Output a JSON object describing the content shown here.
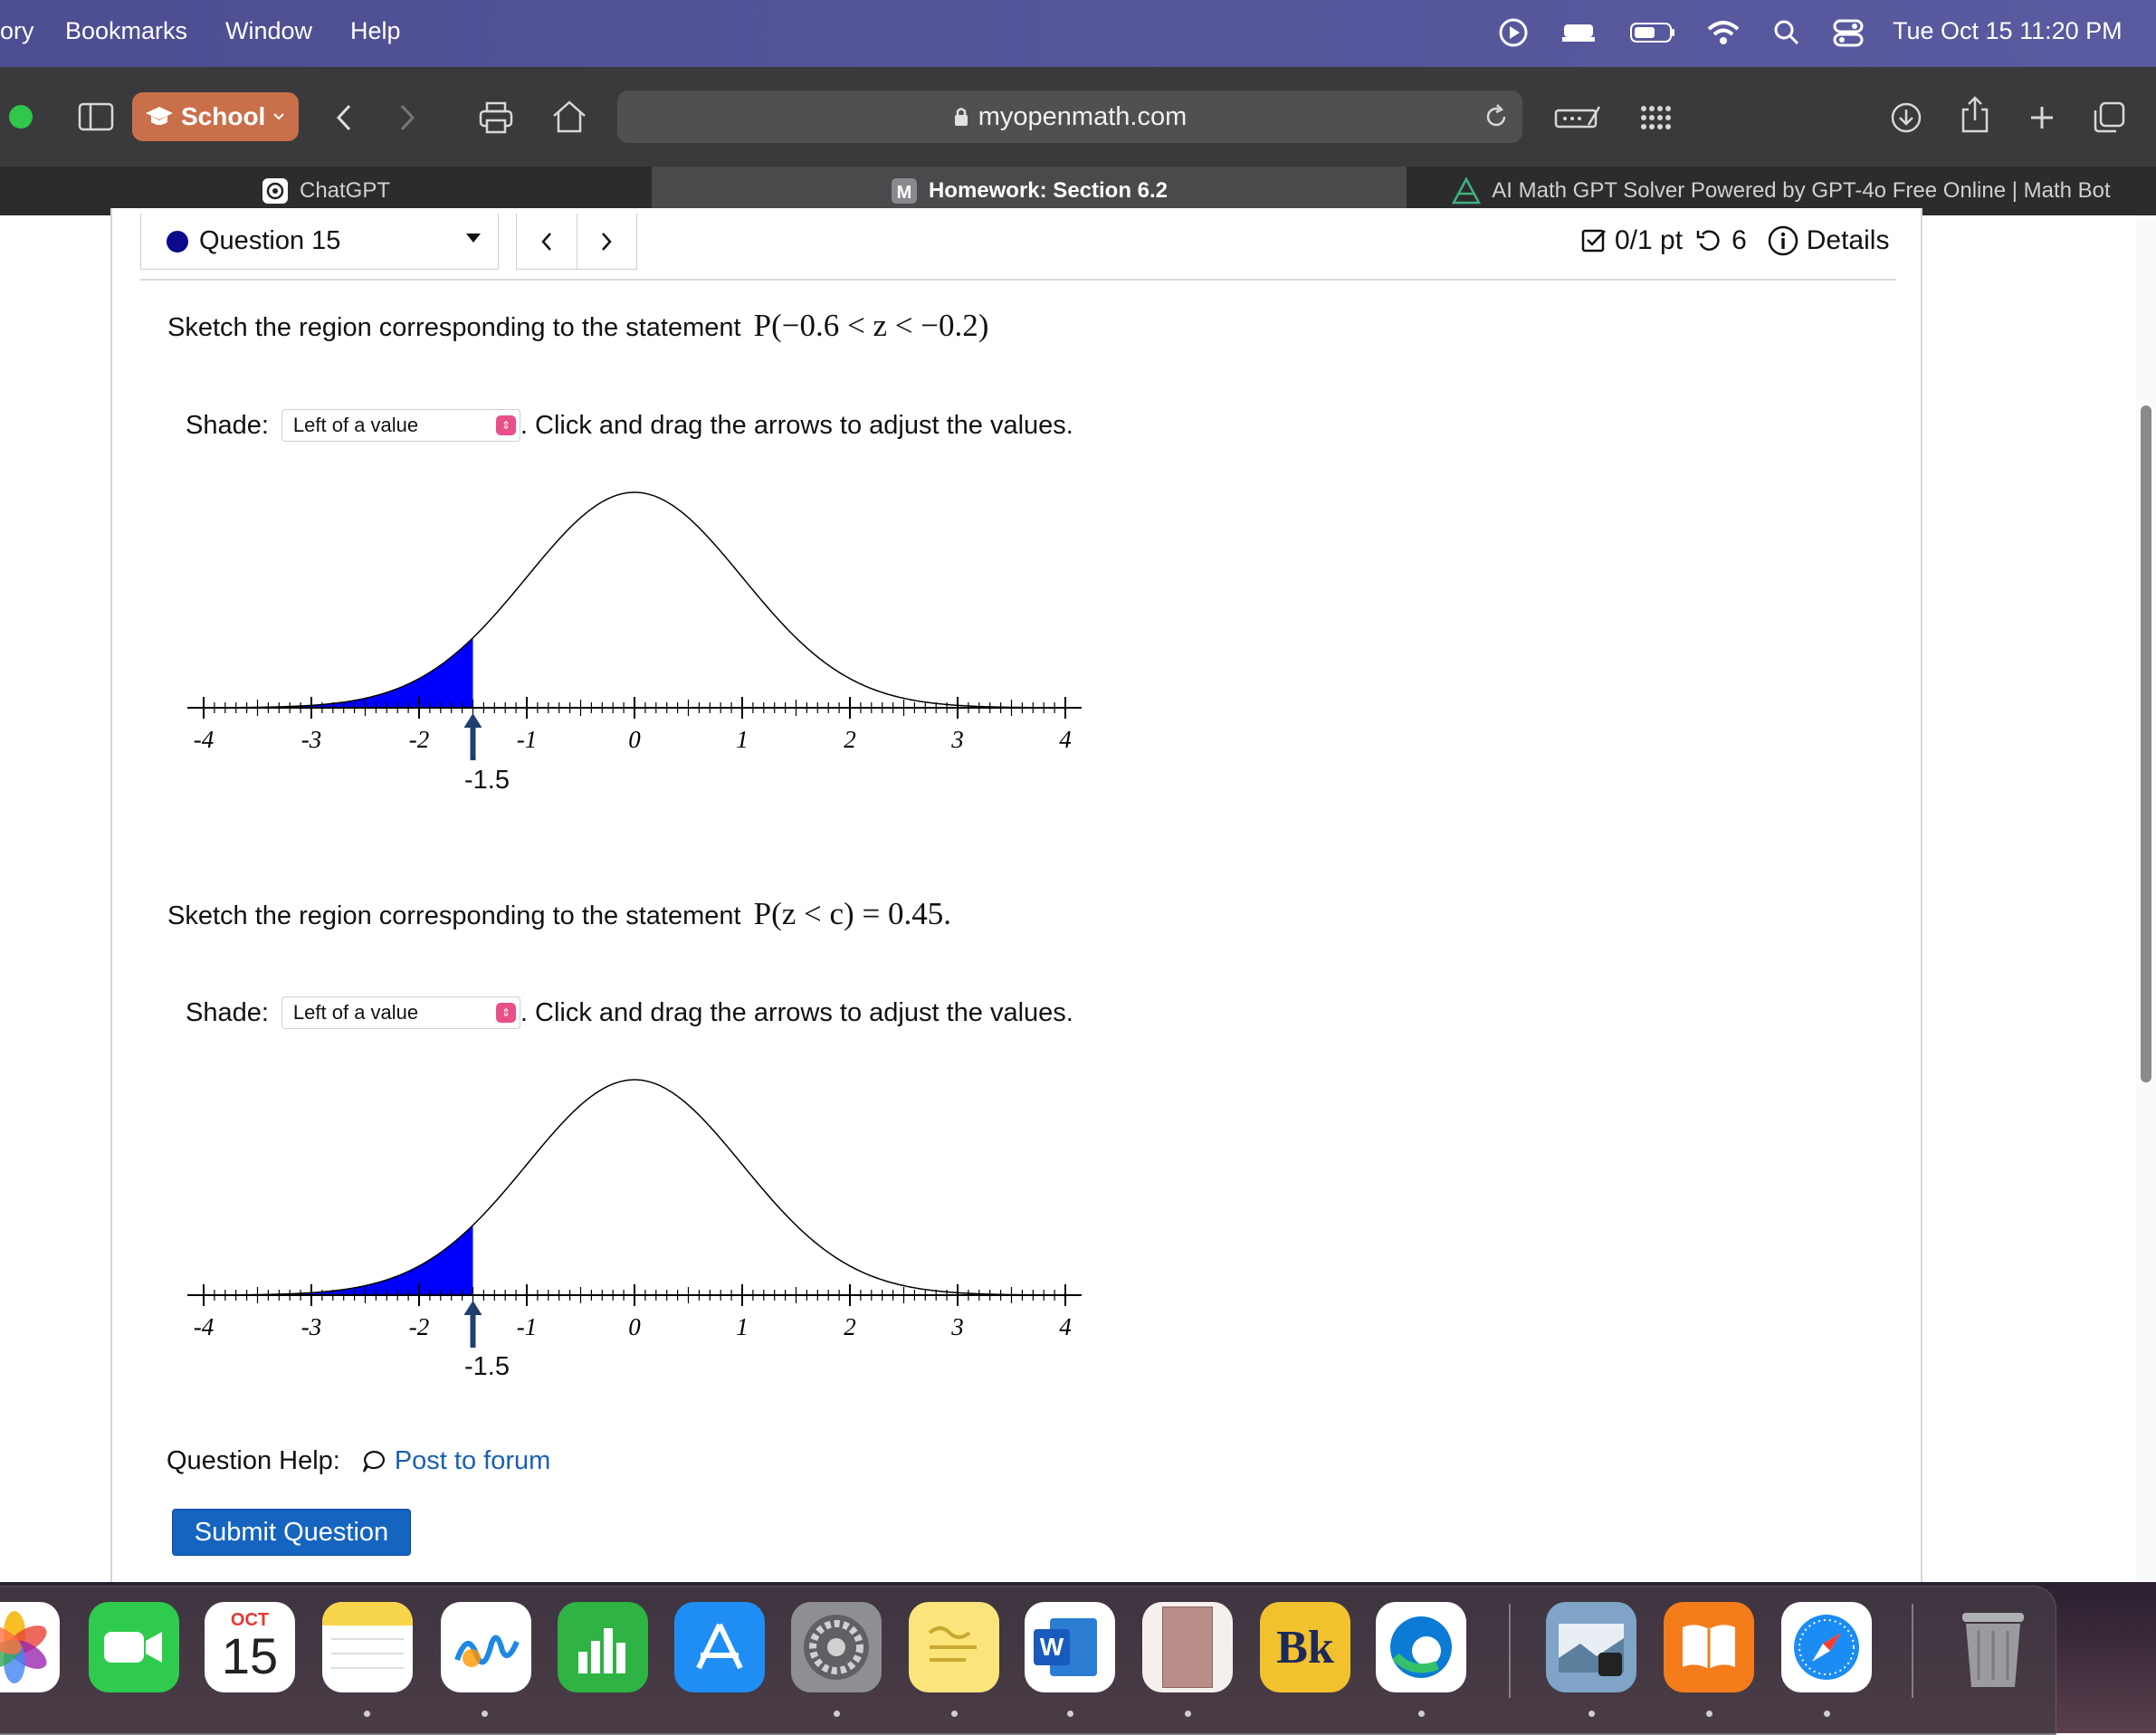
{
  "menubar": {
    "items": [
      "ory",
      "Bookmarks",
      "Window",
      "Help"
    ],
    "clock": "Tue Oct 15  11:20 PM"
  },
  "toolbar": {
    "profile_label": "School",
    "url": "myopenmath.com"
  },
  "tabs": [
    {
      "label": "ChatGPT"
    },
    {
      "label": "Homework: Section 6.2"
    },
    {
      "label": "AI Math GPT Solver Powered by GPT-4o Free Online | Math Bot"
    }
  ],
  "question": {
    "selector_label": "Question 15",
    "score": "0/1 pt",
    "retries": "6",
    "details_label": "Details"
  },
  "part1": {
    "prompt_prefix": "Sketch the region corresponding to the statement",
    "statement": "P(−0.6 < z < −0.2)",
    "shade_label": "Shade:",
    "shade_value": "Left of a value",
    "instruction": ". Click and drag the arrows to adjust the values.",
    "handle_value": "-1.5"
  },
  "part2": {
    "prompt_prefix": "Sketch the region corresponding to the statement",
    "statement": "P(z < c) = 0.45.",
    "shade_label": "Shade:",
    "shade_value": "Left of a value",
    "instruction": ". Click and drag the arrows to adjust the values.",
    "handle_value": "-1.5"
  },
  "chart_data": [
    {
      "type": "area",
      "curve": "standard normal density",
      "x_ticks": [
        "-4",
        "-3",
        "-2",
        "-1",
        "0",
        "1",
        "2",
        "3",
        "4"
      ],
      "xlim": [
        -4,
        4
      ],
      "shaded_region": {
        "from": -4,
        "to": -1.5,
        "color": "#0000ff"
      },
      "handle": -1.5
    },
    {
      "type": "area",
      "curve": "standard normal density",
      "x_ticks": [
        "-4",
        "-3",
        "-2",
        "-1",
        "0",
        "1",
        "2",
        "3",
        "4"
      ],
      "xlim": [
        -4,
        4
      ],
      "shaded_region": {
        "from": -4,
        "to": -1.5,
        "color": "#0000ff"
      },
      "handle": -1.5
    }
  ],
  "help": {
    "label": "Question Help:",
    "post_link": "Post to forum"
  },
  "submit_label": "Submit Question",
  "dock": {
    "calendar_month": "OCT",
    "calendar_day": "15",
    "books_label": "Bk",
    "word_label": "W",
    "apps": [
      "photos-icon",
      "facetime-icon",
      "calendar-icon",
      "notes-icon",
      "freeform-icon",
      "numbers-icon",
      "app-store-icon",
      "system-settings-icon",
      "stickies-icon",
      "word-icon",
      "document-icon",
      "bk-app-icon",
      "edge-icon",
      "preview-icon",
      "books-icon",
      "safari-icon",
      "trash-icon"
    ]
  }
}
